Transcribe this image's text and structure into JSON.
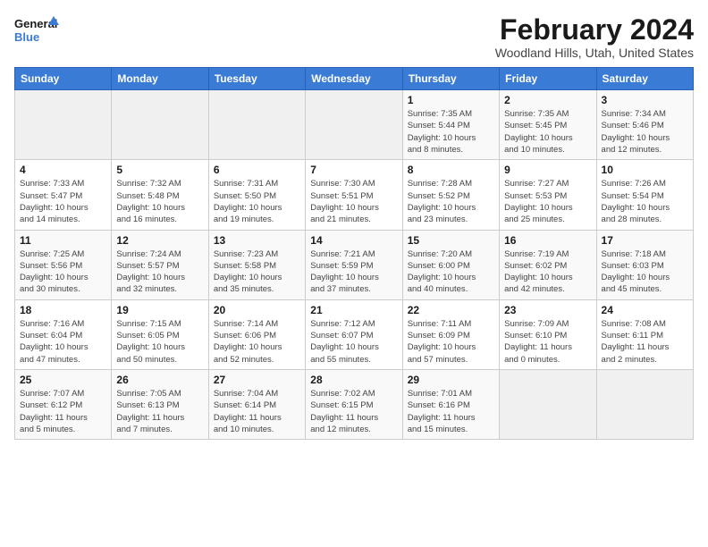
{
  "logo": {
    "line1": "General",
    "line2": "Blue"
  },
  "title": "February 2024",
  "subtitle": "Woodland Hills, Utah, United States",
  "headers": [
    "Sunday",
    "Monday",
    "Tuesday",
    "Wednesday",
    "Thursday",
    "Friday",
    "Saturday"
  ],
  "weeks": [
    [
      {
        "day": "",
        "info": ""
      },
      {
        "day": "",
        "info": ""
      },
      {
        "day": "",
        "info": ""
      },
      {
        "day": "",
        "info": ""
      },
      {
        "day": "1",
        "info": "Sunrise: 7:35 AM\nSunset: 5:44 PM\nDaylight: 10 hours\nand 8 minutes."
      },
      {
        "day": "2",
        "info": "Sunrise: 7:35 AM\nSunset: 5:45 PM\nDaylight: 10 hours\nand 10 minutes."
      },
      {
        "day": "3",
        "info": "Sunrise: 7:34 AM\nSunset: 5:46 PM\nDaylight: 10 hours\nand 12 minutes."
      }
    ],
    [
      {
        "day": "4",
        "info": "Sunrise: 7:33 AM\nSunset: 5:47 PM\nDaylight: 10 hours\nand 14 minutes."
      },
      {
        "day": "5",
        "info": "Sunrise: 7:32 AM\nSunset: 5:48 PM\nDaylight: 10 hours\nand 16 minutes."
      },
      {
        "day": "6",
        "info": "Sunrise: 7:31 AM\nSunset: 5:50 PM\nDaylight: 10 hours\nand 19 minutes."
      },
      {
        "day": "7",
        "info": "Sunrise: 7:30 AM\nSunset: 5:51 PM\nDaylight: 10 hours\nand 21 minutes."
      },
      {
        "day": "8",
        "info": "Sunrise: 7:28 AM\nSunset: 5:52 PM\nDaylight: 10 hours\nand 23 minutes."
      },
      {
        "day": "9",
        "info": "Sunrise: 7:27 AM\nSunset: 5:53 PM\nDaylight: 10 hours\nand 25 minutes."
      },
      {
        "day": "10",
        "info": "Sunrise: 7:26 AM\nSunset: 5:54 PM\nDaylight: 10 hours\nand 28 minutes."
      }
    ],
    [
      {
        "day": "11",
        "info": "Sunrise: 7:25 AM\nSunset: 5:56 PM\nDaylight: 10 hours\nand 30 minutes."
      },
      {
        "day": "12",
        "info": "Sunrise: 7:24 AM\nSunset: 5:57 PM\nDaylight: 10 hours\nand 32 minutes."
      },
      {
        "day": "13",
        "info": "Sunrise: 7:23 AM\nSunset: 5:58 PM\nDaylight: 10 hours\nand 35 minutes."
      },
      {
        "day": "14",
        "info": "Sunrise: 7:21 AM\nSunset: 5:59 PM\nDaylight: 10 hours\nand 37 minutes."
      },
      {
        "day": "15",
        "info": "Sunrise: 7:20 AM\nSunset: 6:00 PM\nDaylight: 10 hours\nand 40 minutes."
      },
      {
        "day": "16",
        "info": "Sunrise: 7:19 AM\nSunset: 6:02 PM\nDaylight: 10 hours\nand 42 minutes."
      },
      {
        "day": "17",
        "info": "Sunrise: 7:18 AM\nSunset: 6:03 PM\nDaylight: 10 hours\nand 45 minutes."
      }
    ],
    [
      {
        "day": "18",
        "info": "Sunrise: 7:16 AM\nSunset: 6:04 PM\nDaylight: 10 hours\nand 47 minutes."
      },
      {
        "day": "19",
        "info": "Sunrise: 7:15 AM\nSunset: 6:05 PM\nDaylight: 10 hours\nand 50 minutes."
      },
      {
        "day": "20",
        "info": "Sunrise: 7:14 AM\nSunset: 6:06 PM\nDaylight: 10 hours\nand 52 minutes."
      },
      {
        "day": "21",
        "info": "Sunrise: 7:12 AM\nSunset: 6:07 PM\nDaylight: 10 hours\nand 55 minutes."
      },
      {
        "day": "22",
        "info": "Sunrise: 7:11 AM\nSunset: 6:09 PM\nDaylight: 10 hours\nand 57 minutes."
      },
      {
        "day": "23",
        "info": "Sunrise: 7:09 AM\nSunset: 6:10 PM\nDaylight: 11 hours\nand 0 minutes."
      },
      {
        "day": "24",
        "info": "Sunrise: 7:08 AM\nSunset: 6:11 PM\nDaylight: 11 hours\nand 2 minutes."
      }
    ],
    [
      {
        "day": "25",
        "info": "Sunrise: 7:07 AM\nSunset: 6:12 PM\nDaylight: 11 hours\nand 5 minutes."
      },
      {
        "day": "26",
        "info": "Sunrise: 7:05 AM\nSunset: 6:13 PM\nDaylight: 11 hours\nand 7 minutes."
      },
      {
        "day": "27",
        "info": "Sunrise: 7:04 AM\nSunset: 6:14 PM\nDaylight: 11 hours\nand 10 minutes."
      },
      {
        "day": "28",
        "info": "Sunrise: 7:02 AM\nSunset: 6:15 PM\nDaylight: 11 hours\nand 12 minutes."
      },
      {
        "day": "29",
        "info": "Sunrise: 7:01 AM\nSunset: 6:16 PM\nDaylight: 11 hours\nand 15 minutes."
      },
      {
        "day": "",
        "info": ""
      },
      {
        "day": "",
        "info": ""
      }
    ]
  ]
}
